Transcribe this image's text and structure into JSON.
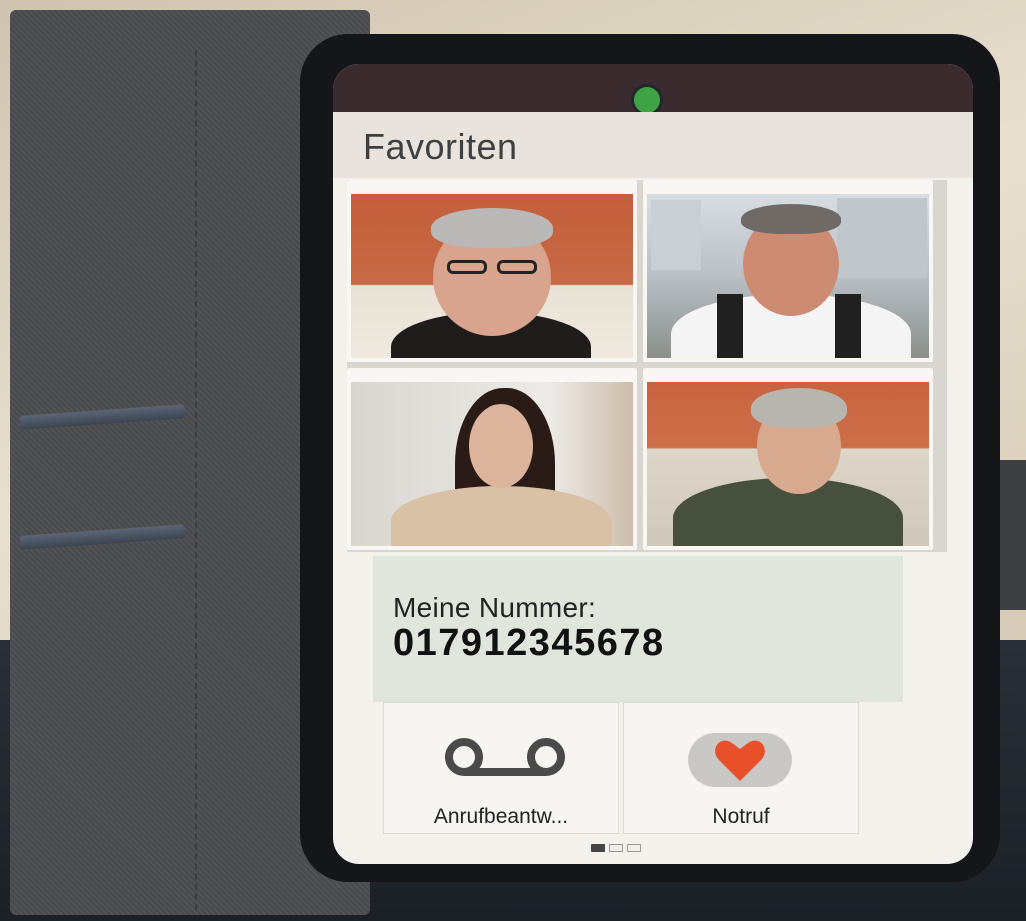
{
  "screen": {
    "title": "Favoriten"
  },
  "favorites": [
    {
      "label": "favorite-contact-1"
    },
    {
      "label": "favorite-contact-2"
    },
    {
      "label": "favorite-contact-3"
    },
    {
      "label": "favorite-contact-4"
    }
  ],
  "my_number": {
    "label": "Meine Nummer:",
    "value": "01791234567​8"
  },
  "actions": {
    "voicemail_label": "Anrufbeantw...",
    "emergency_label": "Notruf"
  },
  "pager": {
    "total_pages": 3,
    "current_page": 1
  },
  "colors": {
    "heart": "#e8502a",
    "screen_bg": "#f3f1ec",
    "number_block_bg": "#e1e6dd"
  },
  "icons": {
    "voicemail": "voicemail-icon",
    "emergency": "heart-icon"
  }
}
